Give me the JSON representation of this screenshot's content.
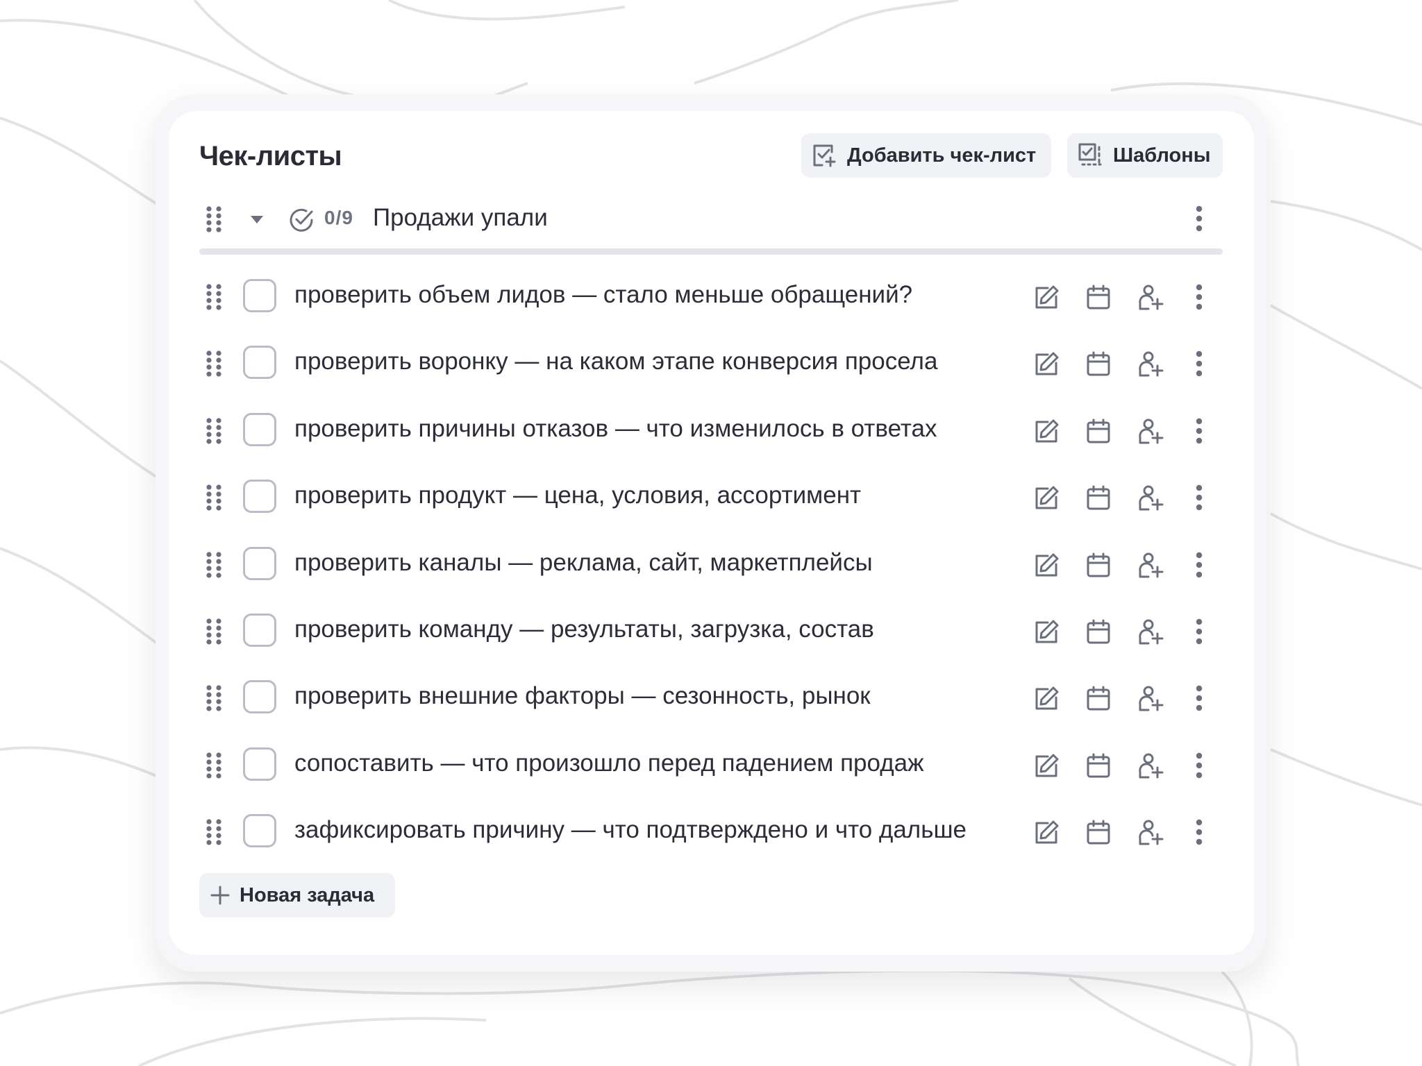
{
  "header": {
    "title": "Чек-листы",
    "add_checklist_label": "Добавить чек-лист",
    "templates_label": "Шаблоны"
  },
  "checklist": {
    "progress": "0/9",
    "title": "Продажи упали",
    "expanded": true
  },
  "tasks": [
    {
      "text": "проверить объем лидов — стало меньше обращений?",
      "done": false
    },
    {
      "text": "проверить воронку — на каком этапе конверсия просела",
      "done": false
    },
    {
      "text": "проверить причины отказов — что изменилось в ответах",
      "done": false
    },
    {
      "text": "проверить продукт — цена, условия, ассортимент",
      "done": false
    },
    {
      "text": "проверить каналы — реклама, сайт, маркетплейсы",
      "done": false
    },
    {
      "text": "проверить команду — результаты, загрузка, состав",
      "done": false
    },
    {
      "text": "проверить внешние факторы — сезонность, рынок",
      "done": false
    },
    {
      "text": "сопоставить — что произошло перед падением продаж",
      "done": false
    },
    {
      "text": "зафиксировать причину — что подтверждено и что дальше",
      "done": false
    }
  ],
  "footer": {
    "new_task_label": "Новая задача"
  },
  "icons": {
    "drag": "drag-handle-icon",
    "collapse": "caret-down-icon",
    "progress": "check-circle-icon",
    "edit": "edit-icon",
    "date": "calendar-icon",
    "assign": "add-user-icon",
    "more": "more-vertical-icon",
    "add": "plus-icon"
  },
  "colors": {
    "icon": "#6b6e7b",
    "text": "#2b2d38",
    "button_bg": "#f1f2f5",
    "checkbox_border": "#b9bcc6",
    "divider": "#e4e5ea"
  }
}
